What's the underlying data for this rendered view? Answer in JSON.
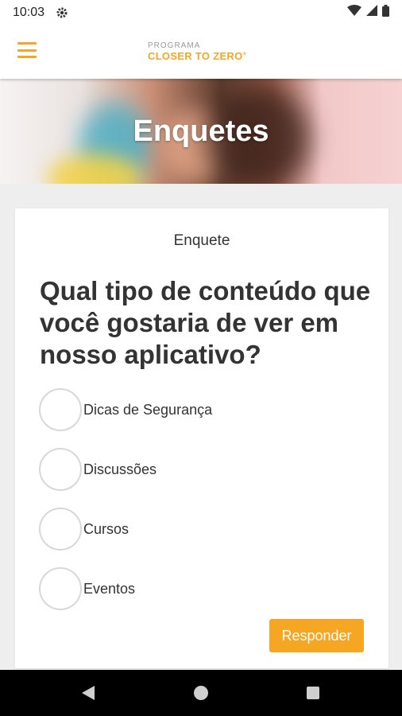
{
  "status_bar": {
    "time": "10:03",
    "icons": [
      "gear-icon",
      "wifi-icon",
      "signal-icon",
      "battery-icon"
    ]
  },
  "app_bar": {
    "menu_icon": "hamburger-menu-icon",
    "brand_top": "PROGRAMA",
    "brand_bottom": "CLOSER TO ZERO",
    "brand_mark": "®"
  },
  "hero": {
    "title": "Enquetes"
  },
  "poll": {
    "label": "Enquete",
    "question": "Qual tipo de conteúdo que você gostaria de ver em nosso aplicativo?",
    "options": [
      {
        "label": "Dicas de Segurança",
        "selected": false
      },
      {
        "label": "Discussões",
        "selected": false
      },
      {
        "label": "Cursos",
        "selected": false
      },
      {
        "label": "Eventos",
        "selected": false
      }
    ],
    "submit_label": "Responder"
  },
  "colors": {
    "accent": "#f5a623",
    "text": "#333333",
    "background": "#eeeeee"
  },
  "nav_bar": {
    "icons": [
      "back-icon",
      "home-icon",
      "recents-icon"
    ]
  }
}
